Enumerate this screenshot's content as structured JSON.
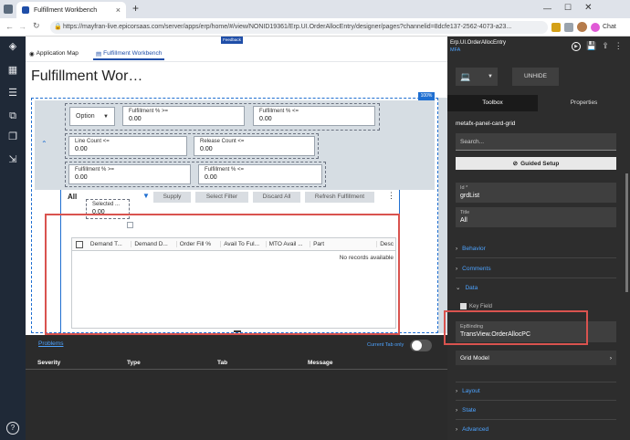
{
  "browser": {
    "tab_title": "Fulfillment Workbench",
    "tab_close": "×",
    "new_tab": "+",
    "url": "https://mayfran-live.epicorsaas.com/server/apps/erp/home/#/view/NONID19361/Erp.UI.OrderAllocEntry/designer/pages?channelid=8dcfe137-2562-4073-a23...",
    "chat_label": "Chat"
  },
  "designer": {
    "feedback_label": "Feedback",
    "tabs": [
      {
        "label": "Application Map"
      },
      {
        "label": "Fulfillment Workbench"
      }
    ],
    "page_title": "Fulfillment Wor…",
    "zoom_badge": "100%",
    "filters": {
      "option_label": "Option",
      "fill1_label": "Fulfillment % >=",
      "fill1_value": "0.00",
      "fill2_label": "Fulfillment % <=",
      "fill2_value": "0.00",
      "line_count_label": "Line Count <=",
      "line_count_value": "0.00",
      "release_count_label": "Release Count <=",
      "release_count_value": "0.00",
      "fill3_label": "Fulfillment % >=",
      "fill3_value": "0.00",
      "fill4_label": "Fulfillment % <=",
      "fill4_value": "0.00"
    },
    "grid_toolbar": {
      "title": "All",
      "selected_label": "Selected ...",
      "selected_value": "0.00",
      "supply": "Supply",
      "select_filter": "Select Filter",
      "discard_all": "Discard All",
      "refresh": "Refresh Fulfillment"
    },
    "grid": {
      "columns": [
        "Demand T...",
        "Demand D...",
        "Order Fill %",
        "Avail To Ful...",
        "MTO Avail ...",
        "Part",
        "Desc"
      ],
      "empty_text": "No records available"
    }
  },
  "problems": {
    "tab_label": "Problems",
    "toggle_label": "Current Tab only",
    "columns": [
      "Severity",
      "Type",
      "Tab",
      "Message"
    ]
  },
  "panel": {
    "title": "Erp.UI.OrderAllocEntry",
    "subtitle": "MFA",
    "unhide": "UNHIDE",
    "tabs": [
      {
        "label": "Toolbox"
      },
      {
        "label": "Properties"
      }
    ],
    "component_name": "metafx-panel-card-grid",
    "search_placeholder": "Search...",
    "guided_setup": "Guided Setup",
    "id_label": "Id *",
    "id_value": "grdList",
    "title_label": "Title",
    "title_value": "All",
    "sections": {
      "behavior": "Behavior",
      "comments": "Comments",
      "data": "Data",
      "layout": "Layout",
      "state": "State",
      "advanced": "Advanced"
    },
    "key_field_label": "Key Field",
    "ep_binding_label": "EpBinding",
    "ep_binding_value": "TransView.OrderAllocPC",
    "grid_model": "Grid Model"
  },
  "colors": {
    "accent": "#1f4ea8",
    "panel_bg": "#2d2d2d",
    "highlight": "#d9534f"
  }
}
